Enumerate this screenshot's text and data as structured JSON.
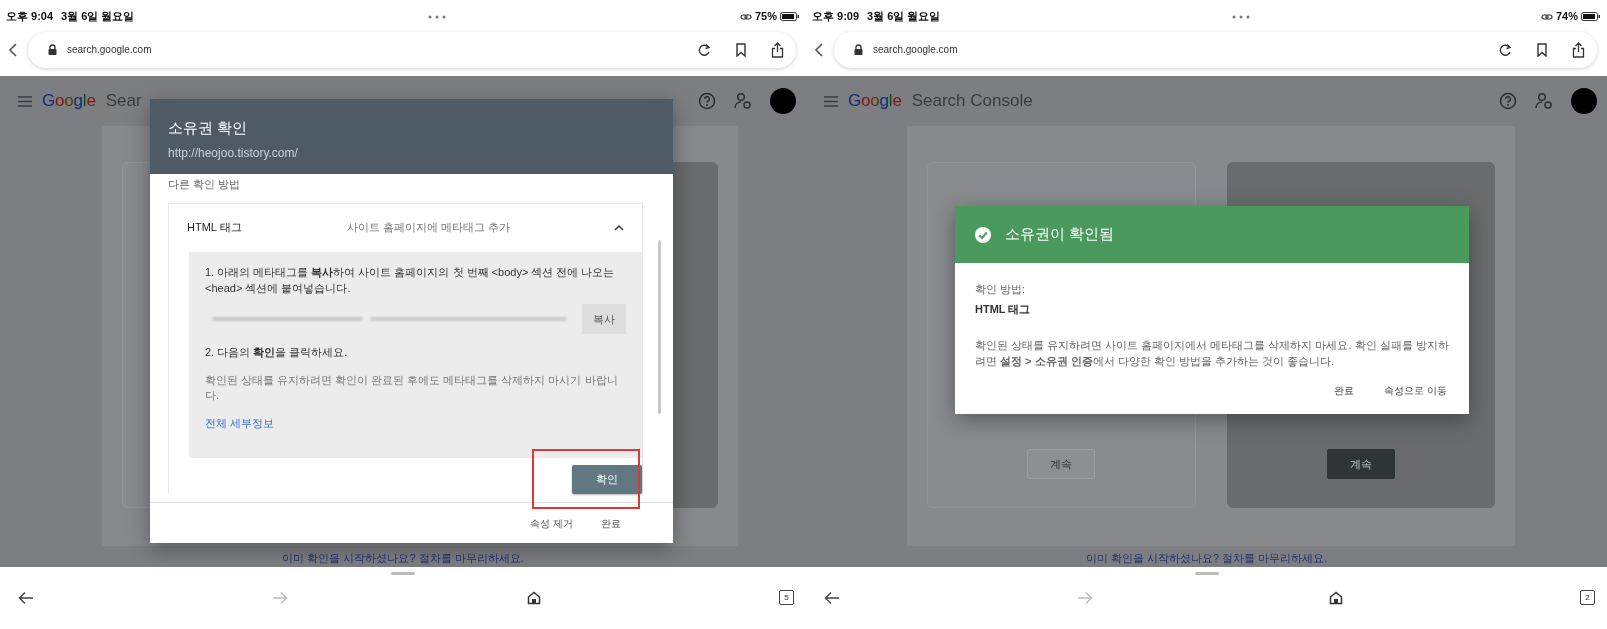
{
  "panels": [
    {
      "status_bar": {
        "time": "오후 9:04",
        "date": "3월 6일 월요일",
        "battery": "75%"
      },
      "address_bar": {
        "url": "search.google.com"
      },
      "app_bar": {
        "logo": "Google",
        "product": "Sear"
      },
      "page": {
        "cards": [
          {
            "selected": false
          },
          {
            "selected": true
          }
        ],
        "footer_link": "이미 확인을 시작하셨나요? 절차를 마무리하세요."
      },
      "dialog": {
        "kind": "verify",
        "title": "소유권 확인",
        "subtitle": "http://heojoo.tistory.com/",
        "section_label": "다른 확인 방법",
        "method": {
          "name": "HTML 태그",
          "description": "사이트 홈페이지에 메타태그 추가",
          "expanded": true,
          "step_1": "1. 아래의 메타태그를 **복사**하여 사이트 홈페이지의 첫 번째 <body> 섹션 전에 나오는 <head> 섹션에 붙여넣습니다.",
          "copy_button": "복사",
          "step_2": "2. 다음의 **확인**을 클릭하세요.",
          "note": "확인된 상태를 유지하려면 확인이 완료된 후에도 메타태그를 삭제하지 마시기 바랍니다.",
          "details_link": "전체 세부정보",
          "confirm_button": "확인",
          "highlighted": true
        },
        "actions": [
          "속성 제거",
          "완료"
        ]
      },
      "tab_count": "5"
    },
    {
      "status_bar": {
        "time": "오후 9:09",
        "date": "3월 6일 월요일",
        "battery": "74%"
      },
      "address_bar": {
        "url": "search.google.com"
      },
      "app_bar": {
        "logo": "Google",
        "product": "Search Console"
      },
      "page": {
        "cards": [
          {
            "selected": false,
            "button": "계속"
          },
          {
            "selected": true,
            "button": "계속"
          }
        ],
        "footer_link": "이미 확인을 시작하셨나요? 절차를 마무리하세요."
      },
      "dialog": {
        "kind": "verified",
        "title": "소유권이 확인됨",
        "method_label": "확인 방법:",
        "method": "HTML 태그",
        "message": "확인된 상태를 유지하려면 사이트 홈페이지에서 메타태그를 삭제하지 마세요. 확인 실패를 방지하려면 **설정 > 소유권 인증**에서 다양한 확인 방법을 추가하는 것이 좋습니다.",
        "actions": [
          "완료",
          "속성으로 이동"
        ]
      },
      "tab_count": "2"
    }
  ]
}
